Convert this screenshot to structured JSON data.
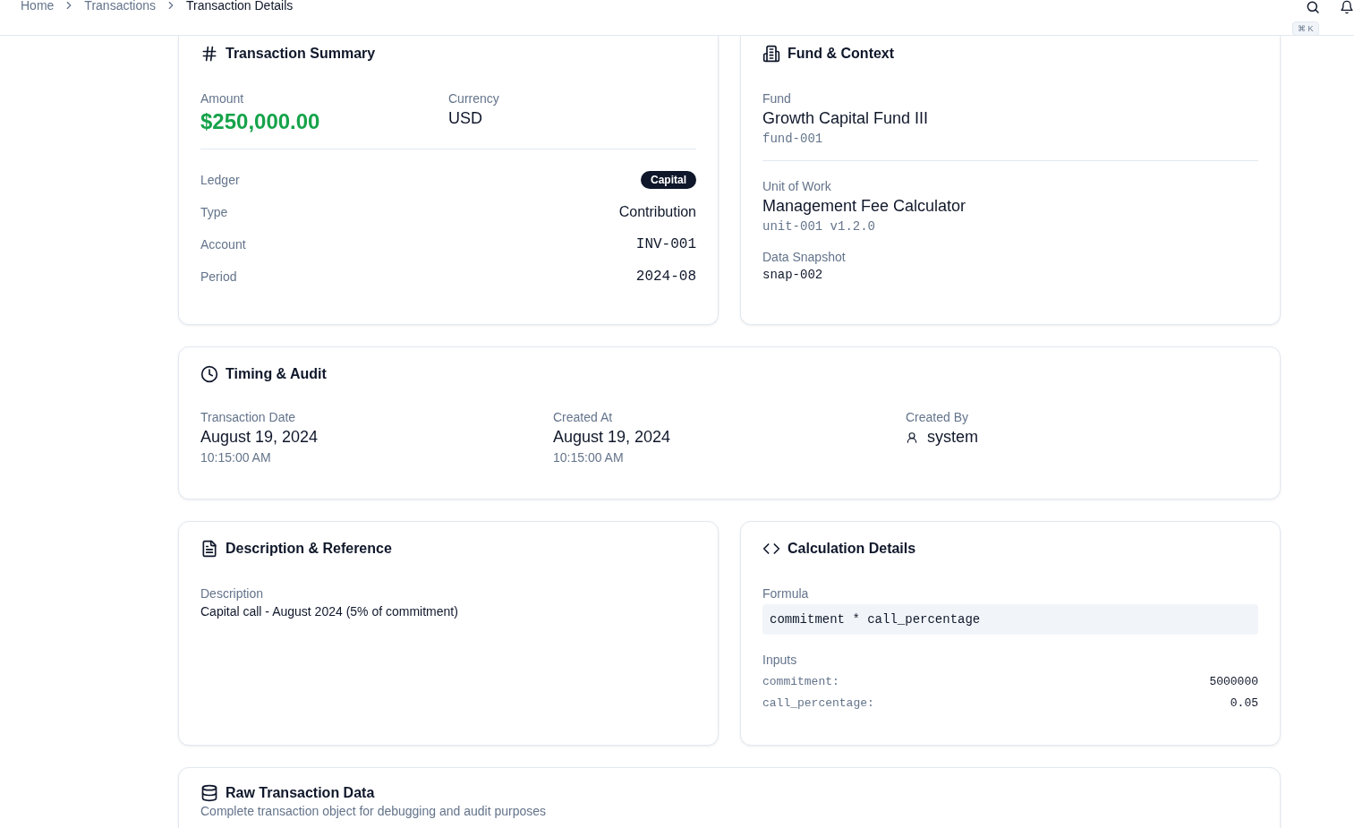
{
  "breadcrumb": [
    {
      "label": "Home",
      "current": false
    },
    {
      "label": "Transactions",
      "current": false
    },
    {
      "label": "Transaction Details",
      "current": true
    }
  ],
  "header": {
    "shortcut": "⌘ K"
  },
  "summary": {
    "title": "Transaction Summary",
    "amount": {
      "label": "Amount",
      "value": "$250,000.00"
    },
    "currency": {
      "label": "Currency",
      "value": "USD"
    },
    "rows": [
      {
        "label": "Ledger",
        "value": "Capital",
        "kind": "badge"
      },
      {
        "label": "Type",
        "value": "Contribution",
        "kind": "text"
      },
      {
        "label": "Account",
        "value": "INV-001",
        "kind": "mono"
      },
      {
        "label": "Period",
        "value": "2024-08",
        "kind": "mono"
      }
    ]
  },
  "fund_context": {
    "title": "Fund & Context",
    "fund": {
      "label": "Fund",
      "name": "Growth Capital Fund III",
      "id": "fund-001"
    },
    "unit": {
      "label": "Unit of Work",
      "name": "Management Fee Calculator",
      "id": "unit-001 v1.2.0"
    },
    "snapshot": {
      "label": "Data Snapshot",
      "value": "snap-002"
    }
  },
  "timing": {
    "title": "Timing & Audit",
    "items": [
      {
        "label": "Transaction Date",
        "value": "August 19, 2024",
        "sub": "10:15:00 AM",
        "kind": "date"
      },
      {
        "label": "Created At",
        "value": "August 19, 2024",
        "sub": "10:15:00 AM",
        "kind": "date"
      },
      {
        "label": "Created By",
        "value": "system",
        "kind": "user"
      }
    ]
  },
  "description": {
    "title": "Description & Reference",
    "label": "Description",
    "text": "Capital call - August 2024 (5% of commitment)"
  },
  "calculation": {
    "title": "Calculation Details",
    "formula_label": "Formula",
    "formula": "commitment * call_percentage",
    "inputs_label": "Inputs",
    "inputs": [
      {
        "name": "commitment:",
        "value": "5000000"
      },
      {
        "name": "call_percentage:",
        "value": "0.05"
      }
    ]
  },
  "raw": {
    "title": "Raw Transaction Data",
    "subtitle": "Complete transaction object for debugging and audit purposes"
  }
}
